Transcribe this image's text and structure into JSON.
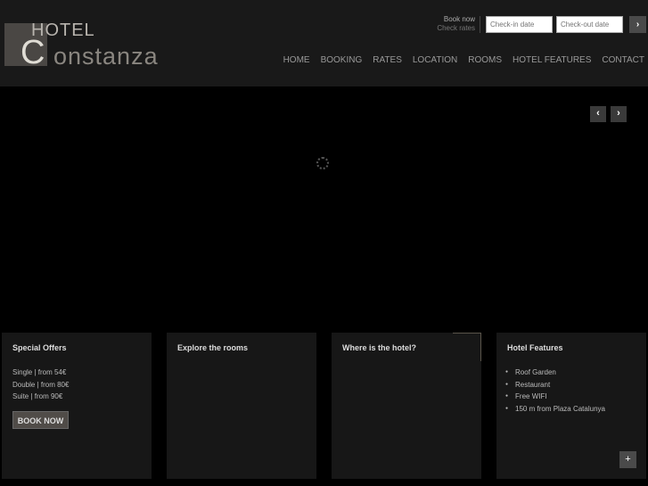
{
  "logo": {
    "hotel": "HOTEL",
    "c": "C",
    "rest": "onstanza"
  },
  "booking": {
    "line1": "Book now",
    "line2": "Check rates",
    "checkin_placeholder": "Check-in date",
    "checkout_placeholder": "Check-out date",
    "go": "›"
  },
  "nav": [
    "HOME",
    "BOOKING",
    "RATES",
    "LOCATION",
    "ROOMS",
    "HOTEL FEATURES",
    "CONTACT"
  ],
  "slider": {
    "prev": "‹",
    "next": "›"
  },
  "cards": {
    "offers": {
      "title": "Special Offers",
      "items": [
        "Single | from 54€",
        "Double | from 80€",
        "Suite | from 90€"
      ],
      "button": "BOOK NOW"
    },
    "rooms": {
      "title": "Explore the rooms"
    },
    "location": {
      "title": "Where is the hotel?"
    },
    "features": {
      "title": "Hotel Features",
      "items": [
        "Roof Garden",
        "Restaurant",
        "Free WIFI",
        "150 m from Plaza Catalunya"
      ],
      "more": "+"
    }
  }
}
